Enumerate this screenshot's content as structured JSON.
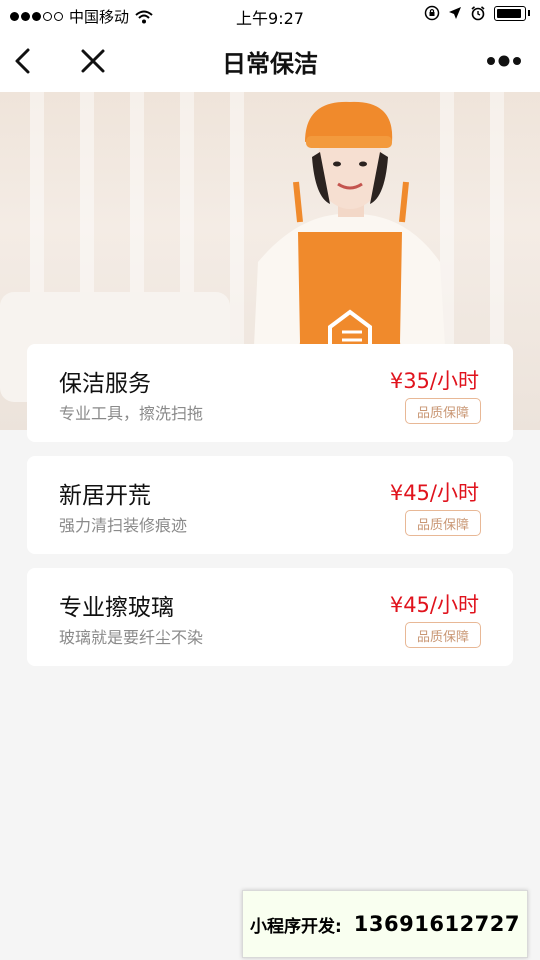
{
  "status_bar": {
    "carrier": "中国移动",
    "time": "上午9:27"
  },
  "nav": {
    "title": "日常保洁"
  },
  "services": [
    {
      "title": "保洁服务",
      "desc": "专业工具，擦洗扫拖",
      "price": "¥35/小时",
      "badge": "品质保障"
    },
    {
      "title": "新居开荒",
      "desc": "强力清扫装修痕迹",
      "price": "¥45/小时",
      "badge": "品质保障"
    },
    {
      "title": "专业擦玻璃",
      "desc": "玻璃就是要纤尘不染",
      "price": "¥45/小时",
      "badge": "品质保障"
    }
  ],
  "developer": {
    "label": "小程序开发:",
    "phone": "13691612727"
  },
  "colors": {
    "price": "#e0131d",
    "badge_border": "#e8b896",
    "apron": "#f08a2c"
  }
}
